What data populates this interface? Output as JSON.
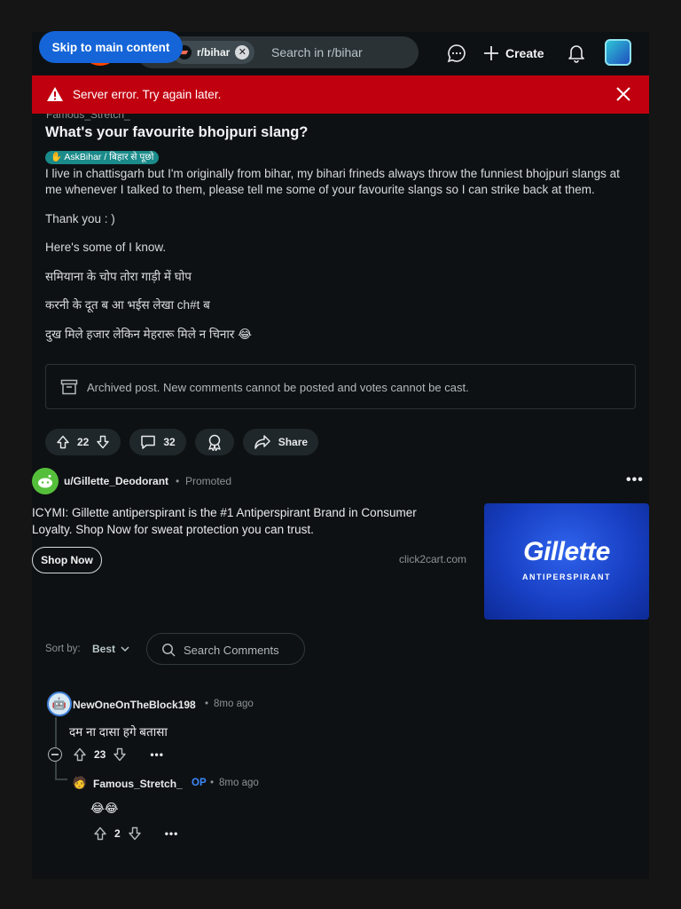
{
  "skip_link": "Skip to main content",
  "header": {
    "subreddit_chip": "r/bihar",
    "search_placeholder": "Search in r/bihar",
    "create_label": "Create"
  },
  "error_banner": {
    "message": "Server error. Try again later."
  },
  "post": {
    "author_partial": "Famous_Stretch_",
    "title": "What's your favourite bhojpuri slang?",
    "flair": "✋ AskBihar / बिहार से पूछो",
    "body": [
      "I live in chattisgarh but I'm originally from bihar, my bihari frineds always throw the funniest bhojpuri slangs at me whenever I talked to them, please tell me some of your favourite slangs so I can strike back at them.",
      "Thank you : )",
      "Here's some of I know.",
      "समियाना के चोप तोरा गाड़ी में घोप",
      "करनी के दूत ब आ भईस लेखा ch#t ब",
      "दुख मिले हजार लेकिन मेहरारू मिले न चिनार 😂"
    ],
    "archived_notice": "Archived post. New comments cannot be posted and votes cannot be cast.",
    "upvotes": "22",
    "comments": "32",
    "share_label": "Share"
  },
  "promoted": {
    "user": "u/Gillette_Deodorant",
    "tag": "Promoted",
    "text": "ICYMI: Gillette antiperspirant is the #1 Antiperspirant Brand in Consumer Loyalty. Shop Now for sweat protection you can trust.",
    "button": "Shop Now",
    "domain": "click2cart.com",
    "image_brand": "Gillette",
    "image_sub": "ANTIPERSPIRANT"
  },
  "comments_bar": {
    "sort_label": "Sort by:",
    "sort_value": "Best",
    "search_placeholder": "Search Comments"
  },
  "comments": [
    {
      "user": "NewOneOnTheBlock198",
      "time": "8mo ago",
      "body": "दम ना दासा हगे बतासा",
      "votes": "23"
    },
    {
      "user": "Famous_Stretch_",
      "op_tag": "OP",
      "time": "8mo ago",
      "body": "😂😂",
      "votes": "2"
    }
  ],
  "colors": {
    "error": "#c1000f",
    "skip_link": "#1565d8",
    "op": "#3d8bfd",
    "flair": "#1a8a8a"
  }
}
